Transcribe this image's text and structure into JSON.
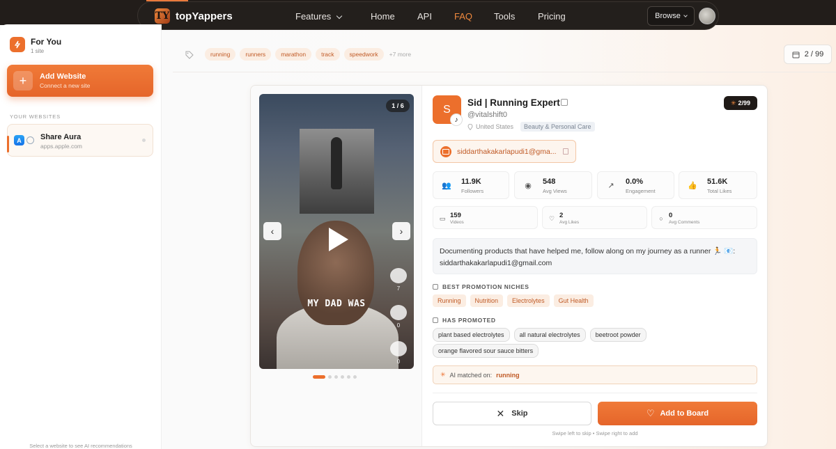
{
  "nav": {
    "brand": "topYappers",
    "brand_logo_letters": "TY",
    "links": [
      "Features",
      "Home",
      "API",
      "FAQ",
      "Tools",
      "Pricing"
    ],
    "active": "FAQ",
    "browse_label": "Browse"
  },
  "sidebar": {
    "for_you_title": "For You",
    "for_you_sub": "1 site",
    "add_title": "Add Website",
    "add_sub": "Connect a new site",
    "section_label": "YOUR WEBSITES",
    "sites": [
      {
        "name": "Share Aura",
        "url": "apps.apple.com"
      }
    ],
    "footer": "Select a website to see AI recommendations"
  },
  "tags": {
    "items": [
      "running",
      "runners",
      "marathon",
      "track",
      "speedwork"
    ],
    "more": "+7 more"
  },
  "counter": "2 / 99",
  "video": {
    "count": "1 / 6",
    "caption": "MY DAD WAS",
    "likes": "7",
    "comments": "0",
    "shares": "0",
    "slides_total": 6,
    "slide_active": 1
  },
  "profile": {
    "initial": "S",
    "name": "Sid | Running Expert",
    "handle": "@vitalshift0",
    "location": "United States",
    "category": "Beauty & Personal Care",
    "rank": "2/99",
    "email": "siddarthakakarlapudi1@gma..."
  },
  "stats": {
    "followers": {
      "value": "11.9K",
      "label": "Followers"
    },
    "views": {
      "value": "548",
      "label": "Avg Views"
    },
    "engagement": {
      "value": "0.0%",
      "label": "Engagement"
    },
    "likes": {
      "value": "51.6K",
      "label": "Total Likes"
    },
    "videos": {
      "value": "159",
      "label": "Videos"
    },
    "avg_likes": {
      "value": "2",
      "label": "Avg Likes"
    },
    "avg_comments": {
      "value": "0",
      "label": "Avg Comments"
    }
  },
  "bio": "Documenting products that have helped me, follow along on my journey as a runner 🏃 📧: siddarthakakarlapudi1@gmail.com",
  "niches": {
    "title": "BEST PROMOTION NICHES",
    "items": [
      "Running",
      "Nutrition",
      "Electrolytes",
      "Gut Health"
    ]
  },
  "promoted": {
    "title": "HAS PROMOTED",
    "items": [
      "plant based electrolytes",
      "all natural electrolytes",
      "beetroot powder",
      "orange flavored sour sauce bitters"
    ]
  },
  "ai_match": {
    "prefix": "AI matched on:",
    "term": "running"
  },
  "actions": {
    "skip": "Skip",
    "add": "Add to Board",
    "hint": "Swipe left to skip • Swipe right to add"
  },
  "colors": {
    "accent": "#ec6f2c",
    "nav_bg": "#231f1c"
  }
}
